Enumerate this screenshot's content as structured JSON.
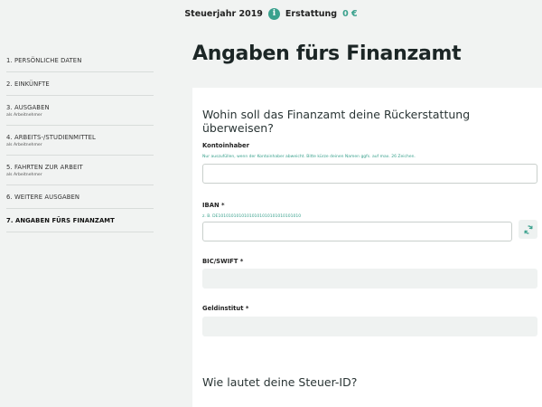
{
  "header": {
    "tax_year_label": "Steuerjahr 2019",
    "info_glyph": "i",
    "refund_label": "Erstattung",
    "refund_value": "0 €"
  },
  "sidebar": {
    "items": [
      {
        "label": "1. PERSÖNLICHE DATEN",
        "sub": ""
      },
      {
        "label": "2. EINKÜNFTE",
        "sub": ""
      },
      {
        "label": "3. AUSGABEN",
        "sub": "als Arbeitnehmer"
      },
      {
        "label": "4. ARBEITS-/STUDIENMITTEL",
        "sub": "als Arbeitnehmer"
      },
      {
        "label": "5. FAHRTEN ZUR ARBEIT",
        "sub": "als Arbeitnehmer"
      },
      {
        "label": "6. WEITERE AUSGABEN",
        "sub": ""
      },
      {
        "label": "7. ANGABEN FÜRS FINANZAMT",
        "sub": ""
      }
    ],
    "active_index": 6
  },
  "main": {
    "title": "Angaben fürs Finanzamt",
    "section1_title": "Wohin soll das Finanzamt deine Rückerstattung überweisen?",
    "account_holder": {
      "label": "Kontoinhaber",
      "hint": "Nur auszufüllen, wenn der Kontoinhaber abweicht. Bitte kürze deinen Namen ggfs. auf max. 26 Zeichen.",
      "value": ""
    },
    "iban": {
      "label": "IBAN *",
      "hint": "z. B. DE10101010101010101010101010101010",
      "value": ""
    },
    "bic": {
      "label": "BIC/SWIFT *",
      "value": ""
    },
    "bank": {
      "label": "Geldinstitut *",
      "value": ""
    },
    "section2_title": "Wie lautet deine Steuer-ID?"
  },
  "colors": {
    "accent": "#3aa18d",
    "background": "#f1f3f2",
    "card": "#ffffff"
  },
  "icons": {
    "info": "info-icon",
    "refresh": "refresh-icon"
  }
}
